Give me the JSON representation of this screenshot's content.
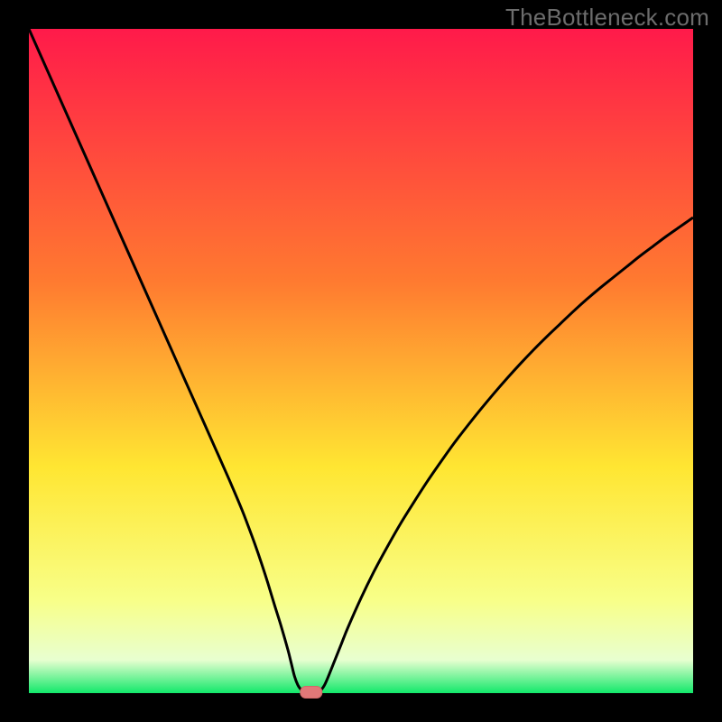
{
  "watermark": "TheBottleneck.com",
  "colors": {
    "black": "#000000",
    "stroke": "#000000",
    "marker_fill": "#e07878",
    "marker_stroke": "#d06868",
    "gradient_top": "#ff1a4a",
    "gradient_mid1": "#ff7a30",
    "gradient_mid2": "#ffe632",
    "gradient_mid3": "#f8ff88",
    "gradient_low": "#e8ffd0",
    "gradient_bottom": "#12e86a"
  },
  "chart_data": {
    "type": "line",
    "title": "",
    "xlabel": "",
    "ylabel": "",
    "xlim": [
      0,
      100
    ],
    "ylim": [
      0,
      100
    ],
    "minimum_marker": {
      "x": 42.5,
      "y": 0
    },
    "series": [
      {
        "name": "bottleneck-curve",
        "points": [
          {
            "x": 0,
            "y": 100
          },
          {
            "x": 2,
            "y": 95.5
          },
          {
            "x": 4,
            "y": 91
          },
          {
            "x": 6,
            "y": 86.5
          },
          {
            "x": 8,
            "y": 82
          },
          {
            "x": 10,
            "y": 77.5
          },
          {
            "x": 12,
            "y": 73
          },
          {
            "x": 14,
            "y": 68.5
          },
          {
            "x": 16,
            "y": 64
          },
          {
            "x": 18,
            "y": 59.5
          },
          {
            "x": 20,
            "y": 55
          },
          {
            "x": 22,
            "y": 50.5
          },
          {
            "x": 24,
            "y": 46
          },
          {
            "x": 26,
            "y": 41.5
          },
          {
            "x": 28,
            "y": 37
          },
          {
            "x": 30,
            "y": 32.5
          },
          {
            "x": 32,
            "y": 27.8
          },
          {
            "x": 33,
            "y": 25.2
          },
          {
            "x": 34,
            "y": 22.5
          },
          {
            "x": 35,
            "y": 19.6
          },
          {
            "x": 36,
            "y": 16.5
          },
          {
            "x": 37,
            "y": 13.2
          },
          {
            "x": 38,
            "y": 10
          },
          {
            "x": 39,
            "y": 6.5
          },
          {
            "x": 39.5,
            "y": 4.5
          },
          {
            "x": 40,
            "y": 2.5
          },
          {
            "x": 40.5,
            "y": 1.2
          },
          {
            "x": 41,
            "y": 0.5
          },
          {
            "x": 41.5,
            "y": 0.15
          },
          {
            "x": 42,
            "y": 0
          },
          {
            "x": 43,
            "y": 0
          },
          {
            "x": 43.5,
            "y": 0.15
          },
          {
            "x": 44,
            "y": 0.5
          },
          {
            "x": 44.5,
            "y": 1.2
          },
          {
            "x": 45,
            "y": 2.3
          },
          {
            "x": 46,
            "y": 4.8
          },
          {
            "x": 47,
            "y": 7.3
          },
          {
            "x": 48,
            "y": 9.8
          },
          {
            "x": 50,
            "y": 14.3
          },
          {
            "x": 52,
            "y": 18.4
          },
          {
            "x": 54,
            "y": 22.1
          },
          {
            "x": 56,
            "y": 25.6
          },
          {
            "x": 58,
            "y": 28.8
          },
          {
            "x": 60,
            "y": 31.9
          },
          {
            "x": 62,
            "y": 34.8
          },
          {
            "x": 64,
            "y": 37.6
          },
          {
            "x": 66,
            "y": 40.2
          },
          {
            "x": 68,
            "y": 42.7
          },
          {
            "x": 70,
            "y": 45.1
          },
          {
            "x": 72,
            "y": 47.4
          },
          {
            "x": 74,
            "y": 49.6
          },
          {
            "x": 76,
            "y": 51.7
          },
          {
            "x": 78,
            "y": 53.7
          },
          {
            "x": 80,
            "y": 55.6
          },
          {
            "x": 82,
            "y": 57.5
          },
          {
            "x": 84,
            "y": 59.3
          },
          {
            "x": 86,
            "y": 61
          },
          {
            "x": 88,
            "y": 62.6
          },
          {
            "x": 90,
            "y": 64.2
          },
          {
            "x": 92,
            "y": 65.8
          },
          {
            "x": 94,
            "y": 67.3
          },
          {
            "x": 96,
            "y": 68.8
          },
          {
            "x": 98,
            "y": 70.2
          },
          {
            "x": 100,
            "y": 71.6
          }
        ]
      }
    ]
  }
}
